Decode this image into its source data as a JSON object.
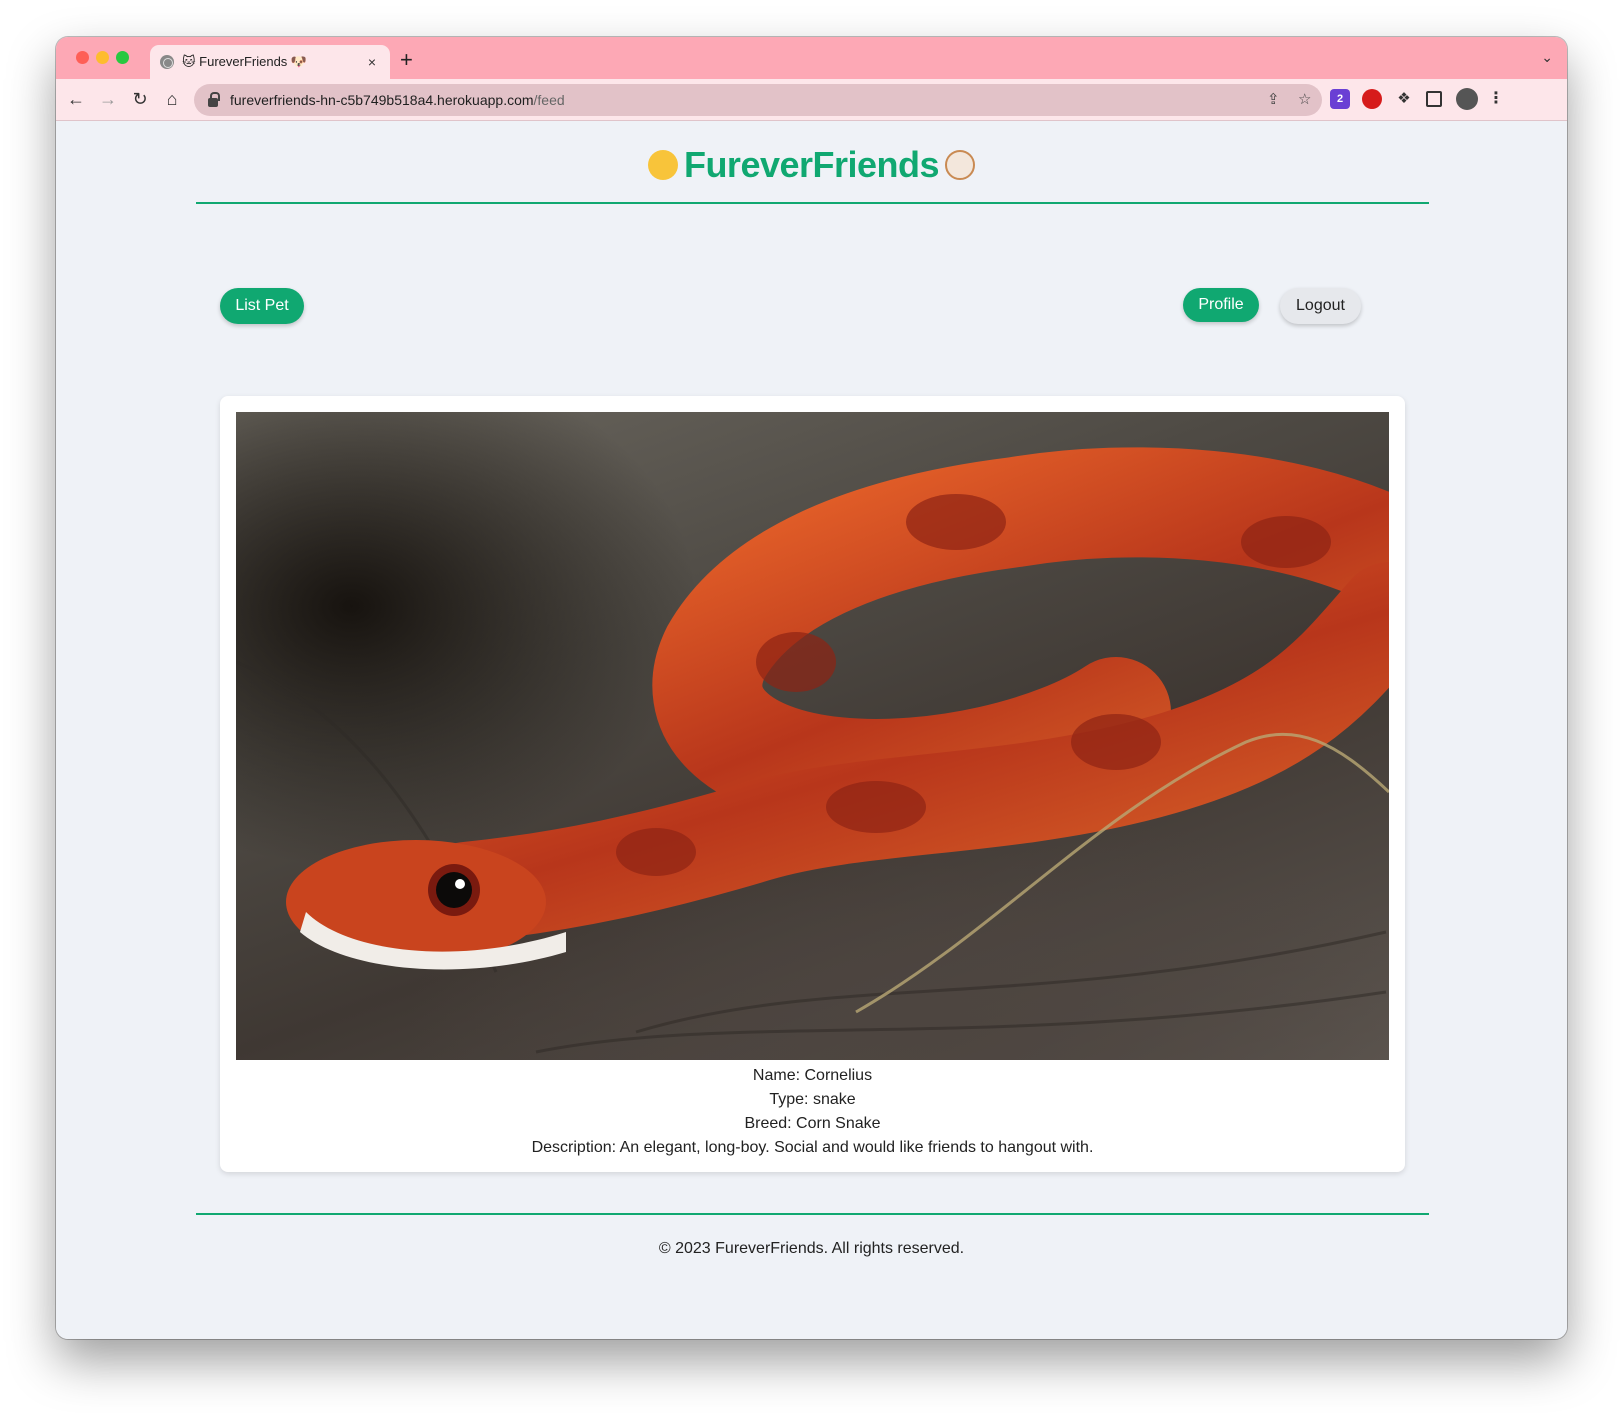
{
  "browser": {
    "tab_title": "🐱 FureverFriends 🐶",
    "tab_close": "×",
    "new_tab": "+",
    "url_host": "fureverfriends-hn-c5b749b518a4.herokuapp.com",
    "url_path": "/feed",
    "extension_badge": "2"
  },
  "header": {
    "title": "FureverFriends"
  },
  "nav": {
    "list_pet_label": "List Pet",
    "profile_label": "Profile",
    "logout_label": "Logout"
  },
  "pet": {
    "name_line": "Name: Cornelius",
    "type_line": "Type: snake",
    "breed_line": "Breed: Corn Snake",
    "description_line": "Description: An elegant, long-boy. Social and would like friends to hangout with."
  },
  "footer": {
    "copyright": "© 2023 FureverFriends. All rights reserved."
  },
  "colors": {
    "brand_green": "#10a871",
    "tab_strip": "#fda8b5",
    "page_bg": "#eff2f7"
  }
}
